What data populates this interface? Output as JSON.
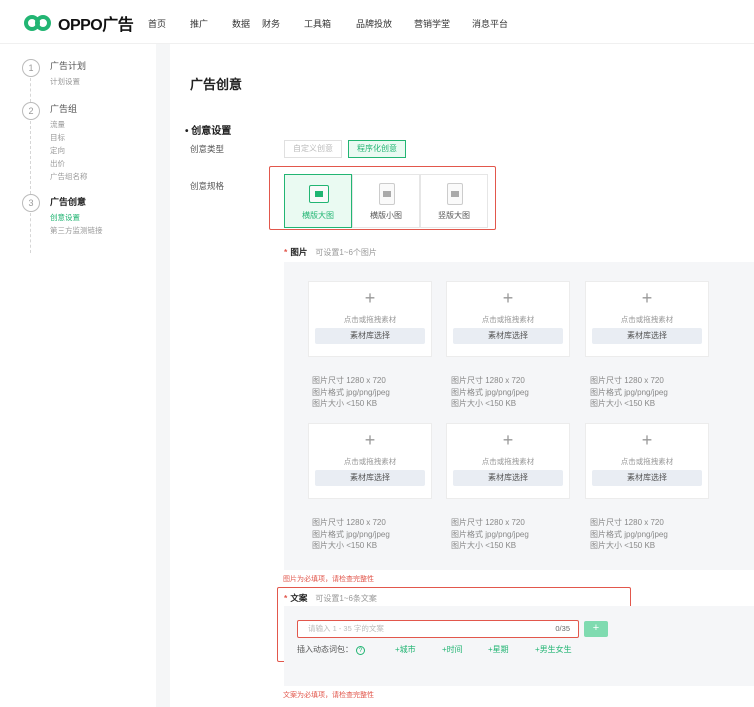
{
  "brand": {
    "name": "OPPO广告",
    "accent": "#22b573",
    "error": "#e2574c"
  },
  "nav": [
    "首页",
    "推广",
    "数据",
    "财务",
    "工具箱",
    "品牌投放",
    "营销学堂",
    "消息平台"
  ],
  "steps": [
    {
      "num": "1",
      "title": "广告计划",
      "subs": [
        "计划设置"
      ]
    },
    {
      "num": "2",
      "title": "广告组",
      "subs": [
        "流量",
        "目标",
        "定向",
        "出价",
        "广告组名称"
      ]
    },
    {
      "num": "3",
      "title": "广告创意",
      "subs": [
        "创意设置",
        "第三方监测链接"
      ]
    }
  ],
  "main": {
    "page_title": "广告创意",
    "section_title": "• 创意设置",
    "creative_type_label": "创意类型",
    "creative_type_options": [
      "自定义创意",
      "程序化创意"
    ],
    "creative_type_selected": "程序化创意",
    "creative_spec_label": "创意规格",
    "specs": [
      "横版大图",
      "横版小图",
      "竖版大图"
    ],
    "spec_selected": "横版大图",
    "images": {
      "required_mark": "*",
      "label": "图片",
      "hint": "可设置1~6个图片",
      "upload_plus": "+",
      "upload_tip": "点击或拖拽素材",
      "library_button": "素材库选择",
      "size_line": "图片尺寸 1280 x 720",
      "format_line": "图片格式 jpg/png/jpeg",
      "weight_line": "图片大小 <150 KB",
      "error": "图片为必填项，请检查完整性"
    },
    "copy": {
      "required_mark": "*",
      "label": "文案",
      "hint": "可设置1~6条文案",
      "placeholder": "请输入 1 - 35 字的文案",
      "count": "0/35",
      "add_button": "+",
      "dynamic_label": "插入动态词包：",
      "help_icon": "?",
      "dynamic_words": [
        "+城市",
        "+时间",
        "+星期",
        "+男生女生"
      ],
      "error": "文案为必填项，请检查完整性"
    }
  }
}
